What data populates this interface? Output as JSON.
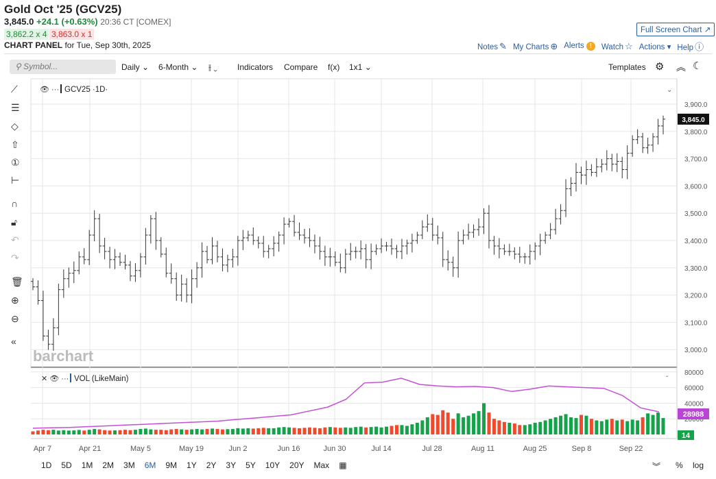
{
  "header": {
    "title": "Gold Oct '25 (GCV25)",
    "last": "3,845.0",
    "change": "+24.1 (+0.63%)",
    "time": "20:36 CT [COMEX]",
    "bid": "3,862.2 x 4",
    "ask": "3,863.0 x 1",
    "panel_label": "CHART PANEL",
    "panel_date": "for Tue, Sep 30th, 2025"
  },
  "links": {
    "full_screen": "Full Screen Chart",
    "notes": "Notes",
    "my_charts": "My Charts",
    "alerts": "Alerts",
    "watch": "Watch",
    "actions": "Actions",
    "help": "Help"
  },
  "toolbar": {
    "symbol_placeholder": "Symbol...",
    "interval": "Daily",
    "range": "6-Month",
    "indicators": "Indicators",
    "compare": "Compare",
    "fx": "f(x)",
    "layout": "1x1",
    "templates": "Templates"
  },
  "chart": {
    "legend": "GCV25 ·1D·",
    "vol_legend": "VOL (LikeMain)",
    "watermark": "barchart",
    "last_label": "3,845.0",
    "vol_line_label": "28988",
    "vol_bar_label": "14",
    "price_ticks": [
      "3,900.0",
      "3,800.0",
      "3,700.0",
      "3,600.0",
      "3,500.0",
      "3,400.0",
      "3,300.0",
      "3,200.0",
      "3,100.0",
      "3,000.0"
    ],
    "vol_ticks": [
      "80000",
      "60000",
      "40000",
      "20000"
    ],
    "date_ticks": [
      "Apr 7",
      "Apr 21",
      "May 5",
      "May 19",
      "Jun 2",
      "Jun 16",
      "Jun 30",
      "Jul 14",
      "Jul 28",
      "Aug 11",
      "Aug 25",
      "Sep 8",
      "Sep 22"
    ]
  },
  "chart_data": {
    "type": "ohlc",
    "ylim": [
      2970,
      3930
    ],
    "vol_ylim": [
      0,
      80000
    ],
    "closes": [
      3230,
      3180,
      3050,
      3020,
      3080,
      3220,
      3260,
      3280,
      3290,
      3340,
      3330,
      3420,
      3480,
      3380,
      3360,
      3330,
      3340,
      3320,
      3310,
      3270,
      3290,
      3340,
      3420,
      3480,
      3400,
      3350,
      3280,
      3260,
      3200,
      3240,
      3200,
      3260,
      3300,
      3360,
      3330,
      3380,
      3340,
      3310,
      3330,
      3340,
      3400,
      3410,
      3420,
      3400,
      3390,
      3360,
      3370,
      3390,
      3420,
      3460,
      3470,
      3430,
      3420,
      3410,
      3400,
      3380,
      3360,
      3340,
      3340,
      3320,
      3300,
      3350,
      3360,
      3360,
      3370,
      3330,
      3360,
      3370,
      3380,
      3380,
      3370,
      3360,
      3380,
      3390,
      3400,
      3420,
      3450,
      3460,
      3420,
      3410,
      3330,
      3320,
      3300,
      3400,
      3420,
      3430,
      3440,
      3450,
      3500,
      3400,
      3380,
      3370,
      3360,
      3360,
      3350,
      3340,
      3340,
      3360,
      3380,
      3400,
      3420,
      3440,
      3480,
      3510,
      3590,
      3610,
      3650,
      3640,
      3660,
      3650,
      3670,
      3680,
      3700,
      3680,
      3690,
      3660,
      3720,
      3770,
      3780,
      3740,
      3750,
      3780,
      3820,
      3845
    ],
    "volume": [
      4000,
      5000,
      6000,
      5500,
      6000,
      5000,
      5500,
      5000,
      5200,
      5800,
      5000,
      6000,
      7000,
      6500,
      5500,
      5000,
      5200,
      5500,
      6000,
      5500,
      6000,
      7000,
      7500,
      6500,
      6000,
      6000,
      5500,
      6500,
      7000,
      6500,
      6000,
      6500,
      7000,
      6500,
      7000,
      7500,
      7000,
      6500,
      6800,
      7000,
      8000,
      7500,
      8000,
      7500,
      8000,
      8500,
      8000,
      8000,
      9000,
      9500,
      9000,
      8500,
      8000,
      8500,
      9000,
      8500,
      8000,
      9000,
      9500,
      9000,
      8500,
      9000,
      8500,
      9500,
      10000,
      9000,
      9500,
      10000,
      9000,
      10000,
      11000,
      12000,
      12000,
      11000,
      13000,
      15000,
      18000,
      22000,
      26000,
      25000,
      31000,
      28000,
      20000,
      27000,
      22000,
      24000,
      27000,
      30000,
      40000,
      28000,
      20000,
      18000,
      16000,
      15000,
      14000,
      12000,
      12000,
      13000,
      15000,
      16000,
      18000,
      20000,
      22000,
      24000,
      26000,
      22000,
      21000,
      25000,
      24000,
      20000,
      18000,
      17000,
      19000,
      20000,
      18000,
      19000,
      17000,
      19000,
      18000,
      22000,
      27000,
      25000,
      28000,
      21000,
      9000
    ],
    "oi_line": [
      8000,
      8500,
      9000,
      10000,
      11000,
      12000,
      13000,
      14000,
      15000,
      16000,
      17000,
      19000,
      21000,
      23000,
      25000,
      30000,
      35000,
      45000,
      66000,
      67000,
      72000,
      64000,
      62000,
      61000,
      61500,
      60000,
      55000,
      58000,
      62000,
      61000,
      60000,
      59000,
      50000,
      34000,
      28988
    ]
  }
}
